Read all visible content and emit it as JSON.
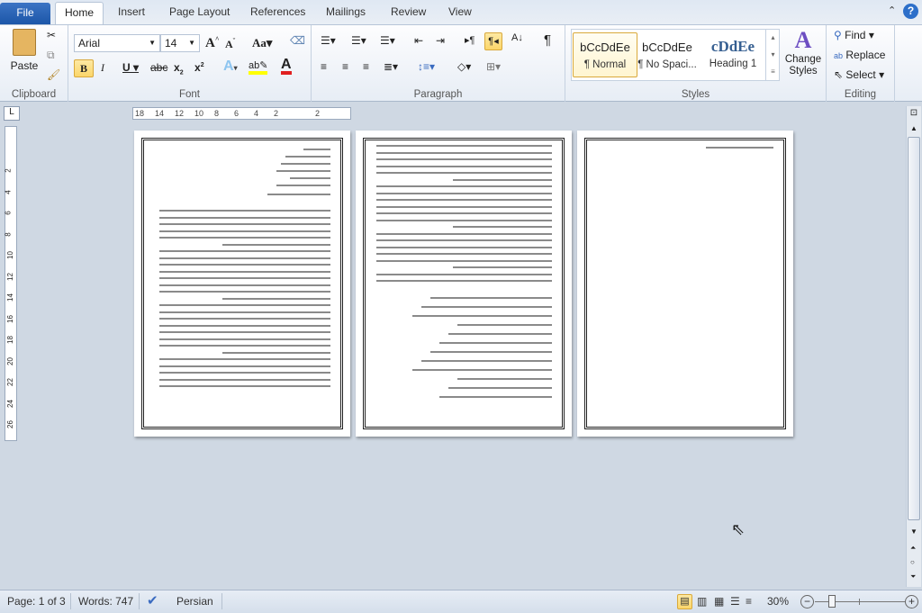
{
  "tabs": {
    "file": "File",
    "items": [
      "Home",
      "Insert",
      "Page Layout",
      "References",
      "Mailings",
      "Review",
      "View"
    ],
    "active": "Home"
  },
  "clipboard": {
    "paste": "Paste",
    "label": "Clipboard"
  },
  "font": {
    "name": "Arial",
    "size": "14",
    "label": "Font",
    "bold_active": true,
    "highlight_color": "#ffff00",
    "font_color": "#e02020"
  },
  "paragraph": {
    "label": "Paragraph",
    "rtl_active": true
  },
  "styles": {
    "label": "Styles",
    "items": [
      {
        "sample": "bCcDdEe",
        "name": "¶ Normal"
      },
      {
        "sample": "bCcDdEe",
        "name": "¶ No Spaci..."
      },
      {
        "sample": "cDdEe",
        "name": "Heading 1"
      }
    ],
    "change": "Change Styles"
  },
  "editing": {
    "label": "Editing",
    "find": "Find",
    "replace": "Replace",
    "select": "Select"
  },
  "ruler": {
    "h_ticks": [
      "18",
      "14",
      "12",
      "10",
      "8",
      "6",
      "4",
      "2",
      "2"
    ],
    "v_ticks": [
      "2",
      "4",
      "6",
      "8",
      "10",
      "12",
      "14",
      "16",
      "18",
      "20",
      "22",
      "24",
      "26"
    ]
  },
  "status": {
    "page": "Page: 1 of 3",
    "words": "Words: 747",
    "language": "Persian",
    "zoom": "30%",
    "zoom_fraction": 0.3
  }
}
